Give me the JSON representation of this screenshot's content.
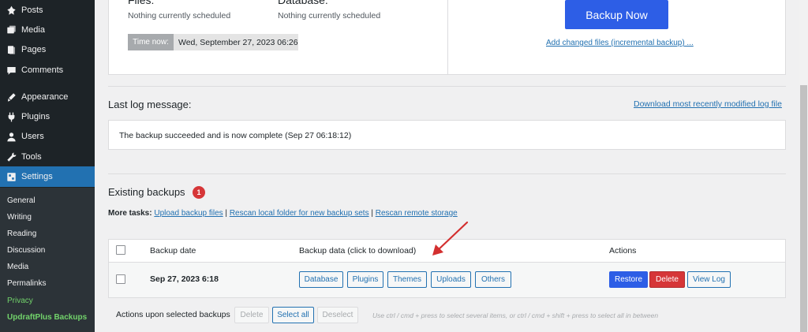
{
  "sidebar": {
    "items": [
      {
        "label": "Posts",
        "icon": "pin-icon"
      },
      {
        "label": "Media",
        "icon": "media-icon"
      },
      {
        "label": "Pages",
        "icon": "pages-icon"
      },
      {
        "label": "Comments",
        "icon": "comments-icon"
      },
      {
        "label": "Appearance",
        "icon": "appearance-icon"
      },
      {
        "label": "Plugins",
        "icon": "plugins-icon"
      },
      {
        "label": "Users",
        "icon": "users-icon"
      },
      {
        "label": "Tools",
        "icon": "tools-icon"
      },
      {
        "label": "Settings",
        "icon": "settings-icon"
      }
    ],
    "submenu": [
      "General",
      "Writing",
      "Reading",
      "Discussion",
      "Media",
      "Permalinks",
      "Privacy",
      "UpdraftPlus Backups"
    ]
  },
  "status": {
    "files_label": "Files:",
    "files_value": "Nothing currently scheduled",
    "database_label": "Database:",
    "database_value": "Nothing currently scheduled",
    "time_now_label": "Time now:",
    "time_now_value": "Wed, September 27, 2023 06:26",
    "backup_now": "Backup Now",
    "incremental_link": "Add changed files (incremental backup) ..."
  },
  "log": {
    "title": "Last log message:",
    "download_link": "Download most recently modified log file",
    "message": "The backup succeeded and is now complete (Sep 27 06:18:12)"
  },
  "existing": {
    "title": "Existing backups",
    "count": "1",
    "more_tasks_label": "More tasks:",
    "tasks": [
      "Upload backup files",
      "Rescan local folder for new backup sets",
      "Rescan remote storage"
    ],
    "sep": "|",
    "columns": {
      "date": "Backup date",
      "data": "Backup data (click to download)",
      "actions": "Actions"
    },
    "rows": [
      {
        "date": "Sep 27, 2023 6:18",
        "data": [
          "Database",
          "Plugins",
          "Themes",
          "Uploads",
          "Others"
        ],
        "actions": {
          "restore": "Restore",
          "delete": "Delete",
          "view_log": "View Log"
        }
      }
    ],
    "bulk": {
      "label": "Actions upon selected backups",
      "delete": "Delete",
      "select_all": "Select all",
      "deselect": "Deselect",
      "hint": "Use ctrl / cmd + press to select several items, or ctrl / cmd + shift + press to select all in between"
    }
  },
  "colors": {
    "accent": "#2d5ee6",
    "danger": "#d63638",
    "sidebar": "#1d2327",
    "active": "#2271b1",
    "annotation": "#d32f2f"
  }
}
